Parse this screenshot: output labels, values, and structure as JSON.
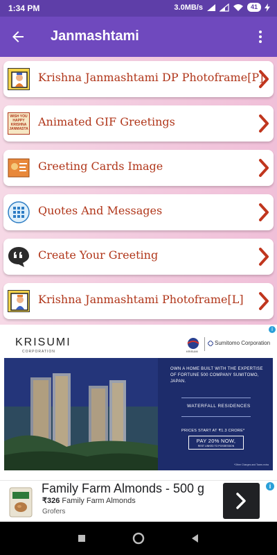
{
  "status_bar": {
    "time": "1:34 PM",
    "network_speed": "3.0MB/s",
    "battery": "41"
  },
  "app_bar": {
    "title": "Janmashtami",
    "back_icon": "arrow-back-icon",
    "menu_icon": "overflow-menu-icon",
    "color": "#6f49be"
  },
  "menu": {
    "items": [
      {
        "label": "Krishna Janmashtami DP Photoframe[P]",
        "icon": "krishna-photoframe-icon"
      },
      {
        "label": "Animated GIF Greetings",
        "icon": "gif-greeting-icon",
        "icon_text": [
          "WISH YOU",
          "HAPPY",
          "KRISHNA",
          "JANMASTA"
        ]
      },
      {
        "label": "Greeting Cards Image",
        "icon": "greeting-card-icon"
      },
      {
        "label": "Quotes And Messages",
        "icon": "grid-apps-icon"
      },
      {
        "label": "Create Your Greeting",
        "icon": "quote-bubble-icon"
      },
      {
        "label": "Krishna Janmashtami Photoframe[L]",
        "icon": "krishna-frame-icon"
      }
    ],
    "label_color": "#b0361a",
    "chevron_color": "#c0361e"
  },
  "ad": {
    "brand": "KRISUMI",
    "brand_sub": "CORPORATION",
    "partner_small": "KRISUMI",
    "partner": "Sumitomo Corporation",
    "headline": "OWN A HOME BUILT WITH THE EXPERTISE OF FORTUNE 500 COMPANY SUMITOMO, JAPAN.",
    "project": "WATERFALL RESIDENCES",
    "price": "PRICES START AT ₹1.3 CRORE*",
    "offer": "PAY 20% NOW,",
    "offer_sub": "REST LINKED TO POSSESSION",
    "note": "*Other Charges and Taxes extra"
  },
  "banner": {
    "title": "Family Farm Almonds - 500 g",
    "price": "₹326",
    "product": "Family Farm Almonds",
    "seller": "Grofers",
    "cta_icon": "chevron-right-icon",
    "info_icon": "info-icon"
  },
  "nav": {
    "recent": "recent-apps-icon",
    "home": "home-icon",
    "back": "back-triangle-icon"
  }
}
